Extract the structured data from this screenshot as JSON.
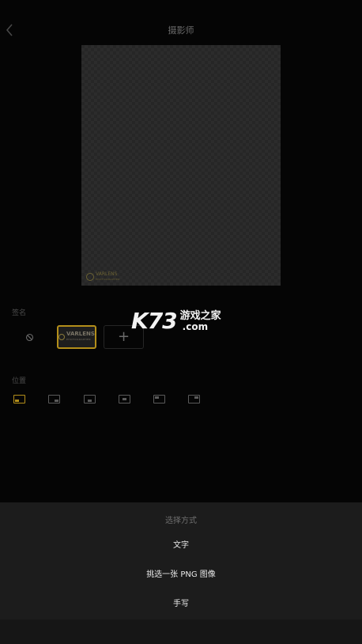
{
  "header": {
    "title": "摄影师"
  },
  "preview": {
    "watermark_text": "VARLENS",
    "watermark_sub": "PHOTOGRAPHER"
  },
  "signature": {
    "label": "签名",
    "thumb_text": "VARLENS",
    "thumb_sub": "PHOTOGRAPHER",
    "add_symbol": "+"
  },
  "position": {
    "label": "位置",
    "options": [
      "bottom-left",
      "bottom-right",
      "bottom-center",
      "center",
      "top-left",
      "top-right"
    ],
    "selected": "bottom-left"
  },
  "site_watermark": {
    "logo": "K73",
    "name": "游戏之家",
    "domain": ".com"
  },
  "sheet": {
    "title": "选择方式",
    "items": [
      "文字",
      "挑选一张 PNG 图像",
      "手写"
    ]
  },
  "colors": {
    "accent": "#b38e1a",
    "background": "#050505",
    "sheet": "#1c1c1c"
  }
}
